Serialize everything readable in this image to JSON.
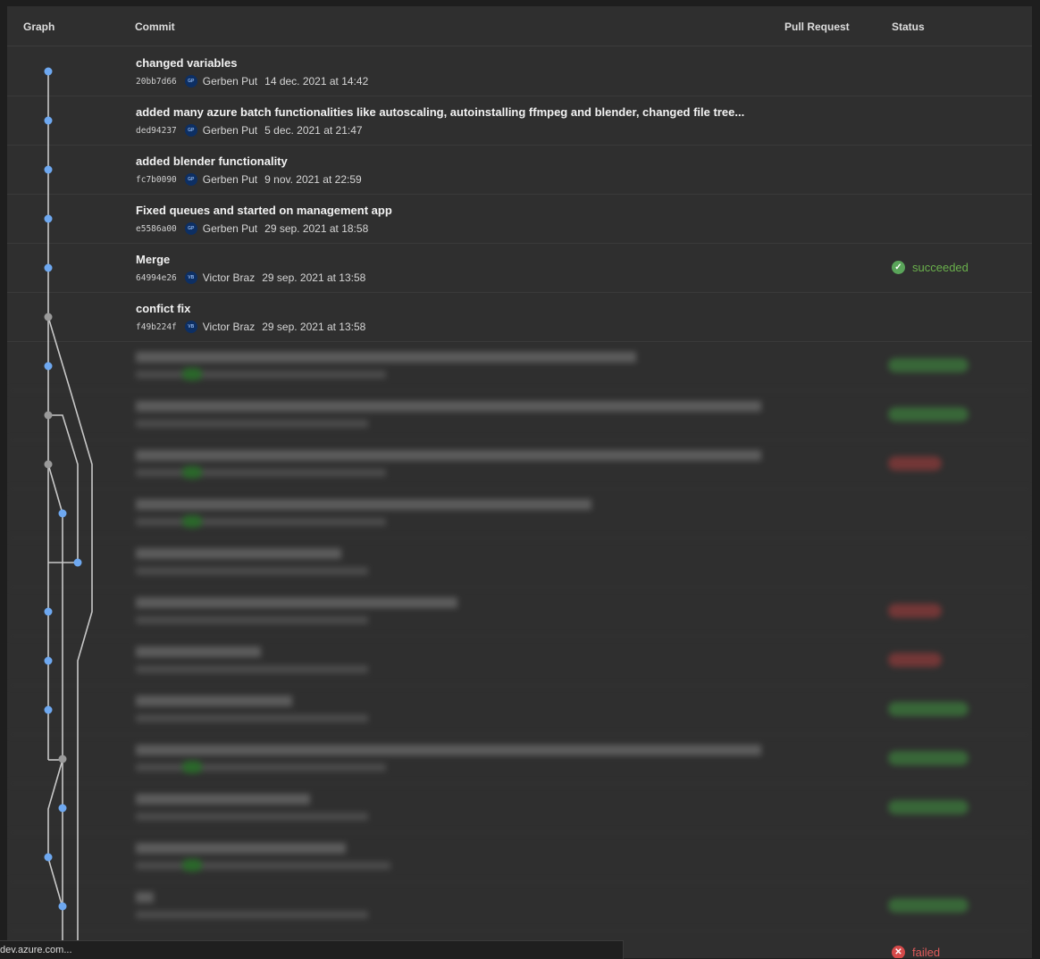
{
  "columns": {
    "graph": "Graph",
    "commit": "Commit",
    "pull_request": "Pull Request",
    "status": "Status"
  },
  "commits": [
    {
      "message": "changed variables",
      "hash": "20bb7d66",
      "avatar": "GP",
      "author": "Gerben Put",
      "date": "14 dec. 2021 at 14:42",
      "status": ""
    },
    {
      "message": "added many azure batch functionalities like autoscaling, autoinstalling ffmpeg and blender, changed file tree...",
      "hash": "ded94237",
      "avatar": "GP",
      "author": "Gerben Put",
      "date": "5 dec. 2021 at 21:47",
      "status": ""
    },
    {
      "message": "added blender functionality",
      "hash": "fc7b0090",
      "avatar": "GP",
      "author": "Gerben Put",
      "date": "9 nov. 2021 at 22:59",
      "status": ""
    },
    {
      "message": "Fixed queues and started on management app",
      "hash": "e5586a00",
      "avatar": "GP",
      "author": "Gerben Put",
      "date": "29 sep. 2021 at 18:58",
      "status": ""
    },
    {
      "message": "Merge",
      "hash": "64994e26",
      "avatar": "VB",
      "author": "Victor Braz",
      "date": "29 sep. 2021 at 13:58",
      "status": "succeeded"
    },
    {
      "message": "confict fix",
      "hash": "f49b224f",
      "avatar": "VB",
      "author": "Victor Braz",
      "date": "29 sep. 2021 at 13:58",
      "status": ""
    }
  ],
  "last_status": "failed",
  "tooltip": "dev.azure.com...",
  "colors": {
    "graph_node": "#6ea8f0",
    "merge_node": "#9a9a9a",
    "line": "#c8c8c8",
    "succeeded": "#6ab04c",
    "failed": "#e05b5b"
  }
}
